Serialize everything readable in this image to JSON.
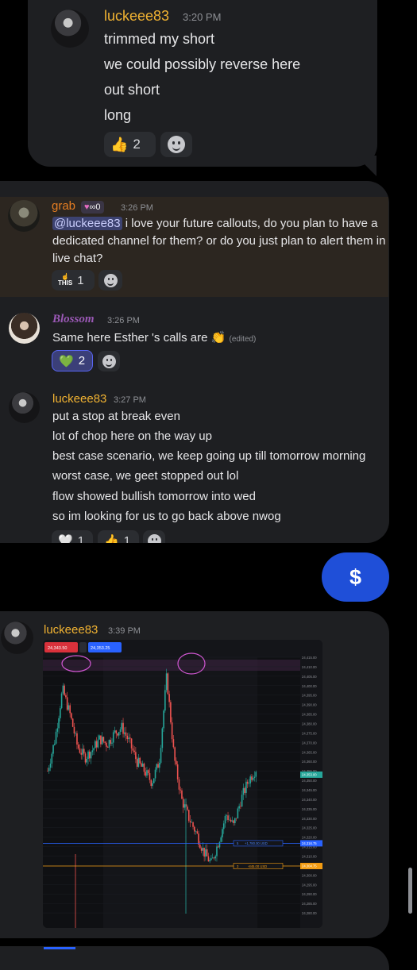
{
  "message1": {
    "username": "luckeee83",
    "timestamp": "3:20 PM",
    "lines": [
      "trimmed my short",
      "we could possibly reverse here",
      "out short",
      "long"
    ],
    "reactions": [
      {
        "emoji": "👍",
        "count": "2"
      }
    ]
  },
  "message2": {
    "username": "grab",
    "badge": "∞0",
    "timestamp": "3:26 PM",
    "mention": "@luckeee83",
    "line1_rest": "i love your future callouts, do you plan to have a",
    "line2": "dedicated channel for them? or do you just plan to alert them in",
    "line3": "live chat?",
    "reactions": [
      {
        "emoji": "THIS",
        "count": "1"
      }
    ]
  },
  "message3": {
    "username": "Blossom",
    "timestamp": "3:26 PM",
    "text": "Same here Esther 's calls are",
    "edited": "(edited)",
    "reactions": [
      {
        "emoji": "💚",
        "count": "2"
      }
    ]
  },
  "message4": {
    "username": "luckeee83",
    "timestamp": "3:27 PM",
    "lines": [
      "put a stop at break even",
      "lot of chop here on the way up",
      "best case scenario, we keep going up till tomorrow morning",
      "worst case, we geet stopped out lol",
      "flow showed bullish tomorrow into wed",
      "so im looking for us to go back above nwog"
    ],
    "reactions": [
      {
        "emoji": "🤍",
        "count": "1"
      },
      {
        "emoji": "👍",
        "count": "1"
      }
    ]
  },
  "dollar_button": "$",
  "message5": {
    "username": "luckeee83",
    "timestamp": "3:39 PM"
  },
  "chart_data": {
    "type": "line",
    "ylim": [
      24275,
      24415
    ],
    "y_ticks": [
      "24,415.00",
      "24,410.00",
      "24,405.00",
      "24,400.00",
      "24,395.00",
      "24,390.00",
      "24,385.00",
      "24,380.00",
      "24,375.00",
      "24,370.00",
      "24,365.00",
      "24,360.00",
      "24,355.00",
      "24,350.00",
      "24,345.00",
      "24,340.00",
      "24,335.00",
      "24,330.00",
      "24,325.00",
      "24,320.00",
      "24,315.00",
      "24,310.00",
      "24,305.00",
      "24,300.00",
      "24,295.00",
      "24,290.00",
      "24,285.00",
      "24,280.00"
    ],
    "sell_label": "24,343.50",
    "buy_label": "24,353.25",
    "price_label": "24,353.00",
    "blue_level": {
      "price": 24316.75,
      "order_label": "+1,780.00 USD",
      "qty": "5"
    },
    "orange_level": {
      "price": 24304.75,
      "order_label": "-845.00 USD",
      "qty": "3"
    },
    "series": [
      {
        "values": [
          24355,
          24372,
          24398,
          24385,
          24368,
          24362,
          24366,
          24372,
          24369,
          24375,
          24378,
          24370,
          24360,
          24355,
          24349,
          24360,
          24405,
          24362,
          24340,
          24330,
          24322,
          24312,
          24306,
          24318,
          24332,
          24326,
          24340,
          24350,
          24356
        ]
      }
    ]
  }
}
